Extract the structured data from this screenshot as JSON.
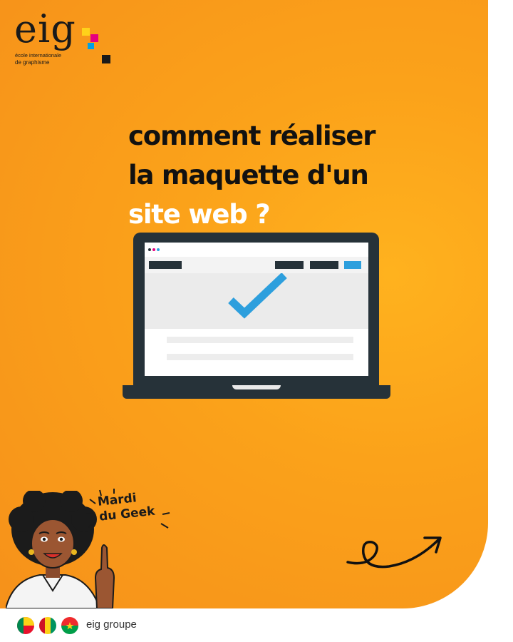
{
  "logo": {
    "wordmark": "eig",
    "tagline_1": "école internationale",
    "tagline_2": "de graphisme"
  },
  "headline": {
    "line_1": "comment réaliser",
    "line_2": "la maquette d'un",
    "line_3": "site web ?"
  },
  "badge": {
    "line_1": "Mardi",
    "line_2": "du Geek"
  },
  "footer": {
    "label": "eig groupe"
  },
  "colors": {
    "background_orange": "#f9a11b",
    "laptop_dark": "#263239",
    "check_blue": "#2d9fdd",
    "headline_dark": "#111111",
    "headline_white": "#ffffff",
    "logo_yellow": "#ffd21a",
    "logo_magenta": "#e6007e",
    "logo_cyan": "#00a0e3",
    "logo_black": "#1a1a1a"
  },
  "icons": {
    "logo_squares": "cmyk-squares-icon",
    "check": "checkmark-icon",
    "arrow": "loop-arrow-icon",
    "flags": [
      "benin-flag-icon",
      "guinea-flag-icon",
      "burkina-faso-flag-icon"
    ]
  }
}
